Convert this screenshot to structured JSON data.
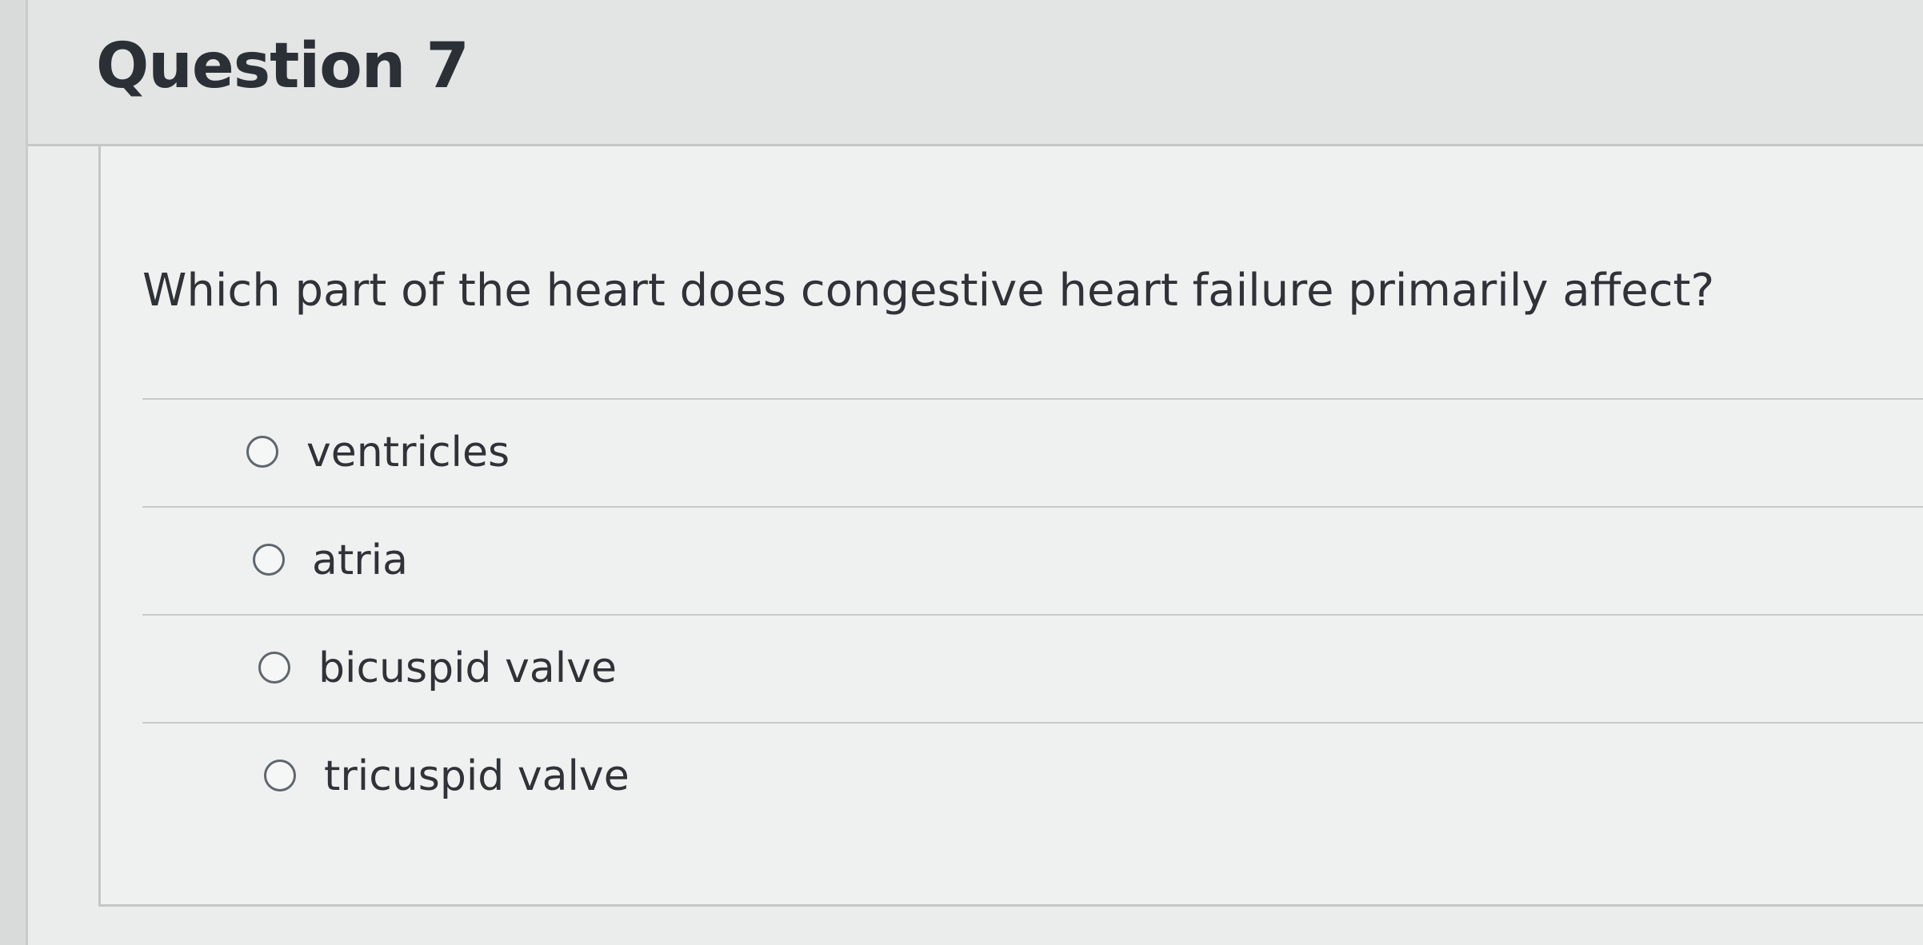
{
  "question": {
    "title": "Question 7",
    "text": "Which part of the heart does congestive heart failure primarily affect?",
    "answers": [
      {
        "label": "ventricles",
        "selected": false
      },
      {
        "label": "atria",
        "selected": false
      },
      {
        "label": "bicuspid valve",
        "selected": false
      },
      {
        "label": "tricuspid valve",
        "selected": false
      }
    ]
  }
}
